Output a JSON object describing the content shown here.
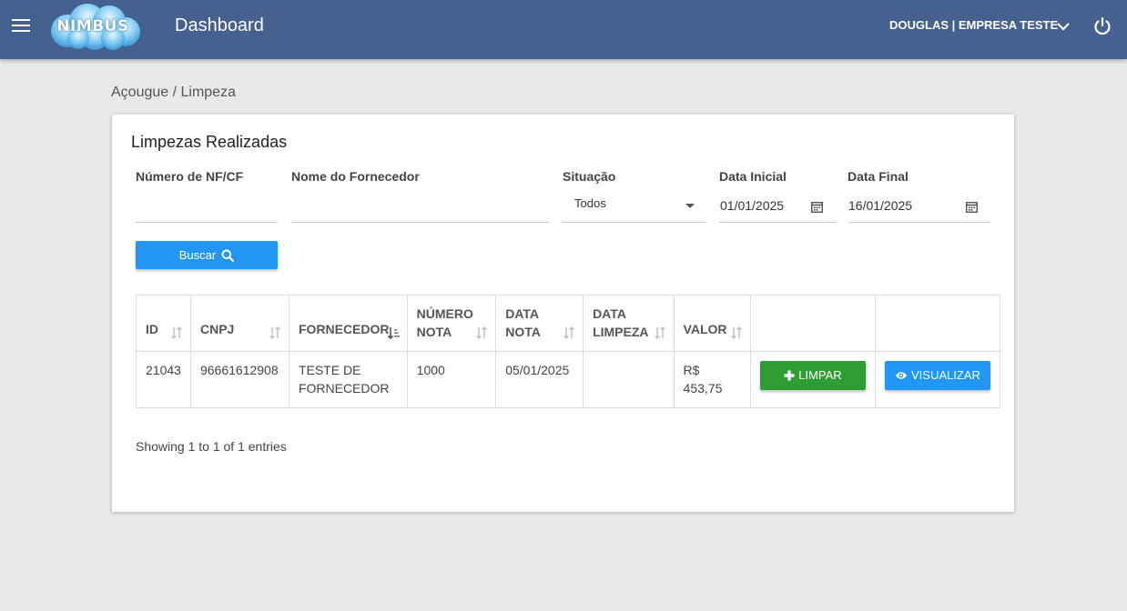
{
  "header": {
    "logo_text": "NIMBUS",
    "title": "Dashboard",
    "user": "DOUGLAS | EMPRESA TESTE",
    "menu_icon": "hamburger-icon",
    "dropdown_icon": "chevron-down-icon",
    "power_icon": "power-icon",
    "color": "#44618f"
  },
  "breadcrumb": "Açougue / Limpeza",
  "card": {
    "title": "Limpezas Realizadas",
    "filters": {
      "nf_label": "Número de NF/CF",
      "nf_value": "",
      "fornecedor_label": "Nome do Fornecedor",
      "fornecedor_value": "",
      "situacao_label": "Situação",
      "situacao_value": "Todos",
      "data_inicial_label": "Data Inicial",
      "data_inicial_value": "01/01/2025",
      "data_final_label": "Data Final",
      "data_final_value": "16/01/2025"
    },
    "search_button": "Buscar",
    "table": {
      "headers": [
        "ID",
        "CNPJ",
        "FORNECEDOR",
        "NÚMERO NOTA",
        "DATA NOTA",
        "DATA LIMPEZA",
        "VALOR"
      ],
      "header_lines": {
        "numero_1": "NÚMERO",
        "numero_2": "NOTA",
        "data_nota_1": "DATA",
        "data_nota_2": "NOTA",
        "data_limpeza_1": "DATA",
        "data_limpeza_2": "LIMPEZA"
      },
      "rows": [
        {
          "id": "21043",
          "cnpj": "96661612908",
          "fornecedor_1": "TESTE DE",
          "fornecedor_2": "FORNECEDOR",
          "numero_nota": "1000",
          "data_nota": "05/01/2025",
          "data_limpeza": "",
          "valor": "R$ 453,75",
          "limpar_label": "LIMPAR",
          "visualizar_label": "VISUALIZAR"
        }
      ]
    },
    "entries_text": "Showing 1 to 1 of 1 entries"
  },
  "colors": {
    "primary": "#2196f3",
    "success": "#2e9e34",
    "background": "#e9e9e9"
  }
}
